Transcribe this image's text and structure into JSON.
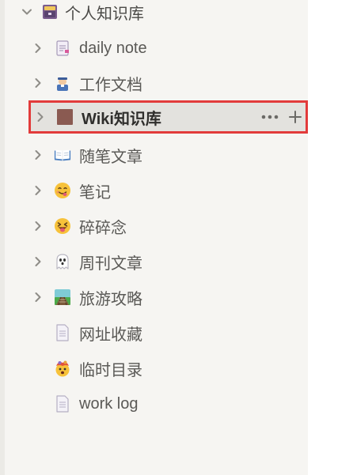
{
  "root": {
    "label": "个人知识库",
    "icon": "card-box-icon",
    "expanded": true
  },
  "items": [
    {
      "label": "daily note",
      "icon": "notepad-icon",
      "has_children": true
    },
    {
      "label": "工作文档",
      "icon": "office-worker-icon",
      "has_children": true
    },
    {
      "label": "Wiki知识库",
      "icon": "brown-square-icon",
      "has_children": true,
      "selected": true
    },
    {
      "label": "随笔文章",
      "icon": "open-book-icon",
      "has_children": true
    },
    {
      "label": "笔记",
      "icon": "yum-face-icon",
      "has_children": true
    },
    {
      "label": "碎碎念",
      "icon": "squinting-tongue-face-icon",
      "has_children": true
    },
    {
      "label": "周刊文章",
      "icon": "ghost-icon",
      "has_children": true
    },
    {
      "label": "旅游攻略",
      "icon": "railway-track-icon",
      "has_children": true
    },
    {
      "label": "网址收藏",
      "icon": "page-icon",
      "has_children": false
    },
    {
      "label": "临时目录",
      "icon": "exploding-head-icon",
      "has_children": false
    },
    {
      "label": "work log",
      "icon": "page-icon",
      "has_children": false
    }
  ],
  "colors": {
    "sidebar_bg": "#f6f5f2",
    "selected_bg": "#e3e2de",
    "highlight_border": "#e23b3b",
    "text": "#5a5956"
  }
}
